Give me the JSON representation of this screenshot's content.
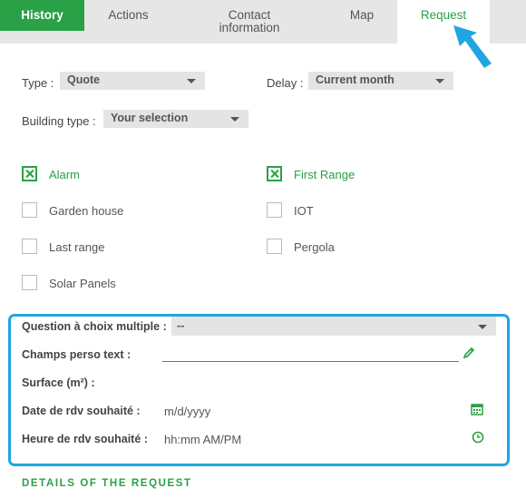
{
  "tabs": [
    {
      "label": "History"
    },
    {
      "label": "Actions"
    },
    {
      "label": "Contact\ninformation"
    },
    {
      "label": "Map"
    },
    {
      "label": "Request"
    }
  ],
  "form": {
    "type_label": "Type :",
    "type_value": "Quote",
    "delay_label": "Delay :",
    "delay_value": "Current month",
    "building_label": "Building type :",
    "building_value": "Your selection"
  },
  "checkboxes": [
    {
      "label": "Alarm",
      "checked": true
    },
    {
      "label": "First Range",
      "checked": true
    },
    {
      "label": "Garden house",
      "checked": false
    },
    {
      "label": "IOT",
      "checked": false
    },
    {
      "label": "Last range",
      "checked": false
    },
    {
      "label": "Pergola",
      "checked": false
    },
    {
      "label": "Solar Panels",
      "checked": false
    }
  ],
  "custom": {
    "question_label": "Question à choix multiple :",
    "question_value": "--",
    "text_label": "Champs perso text :",
    "surface_label": "Surface (m²) :",
    "date_label": "Date de rdv souhaité :",
    "date_placeholder": "m/d/yyyy",
    "time_label": "Heure de rdv souhaité :",
    "time_placeholder": "hh:mm AM/PM"
  },
  "details_heading": "DETAILS OF THE REQUEST",
  "colors": {
    "accent": "#2aa147",
    "highlight": "#1fa6e0"
  },
  "icons": [
    "pencil-icon",
    "calendar-icon",
    "clock-icon",
    "pointer-arrow-icon",
    "chevron-down-icon"
  ]
}
